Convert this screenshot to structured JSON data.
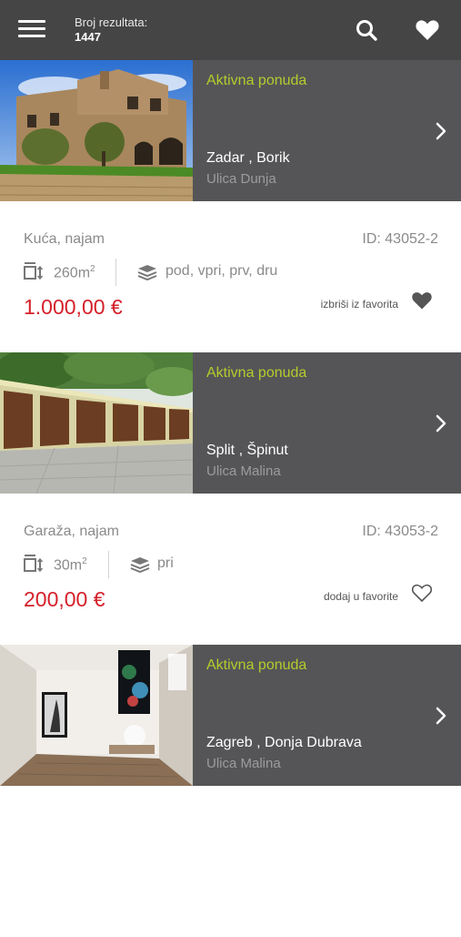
{
  "header": {
    "results_label": "Broj rezultata:",
    "results_count": "1447"
  },
  "listings": [
    {
      "status": "Aktivna ponuda",
      "city": "Zadar , Borik",
      "street": "Ulica Dunja",
      "type": "Kuća, najam",
      "id": "ID: 43052-2",
      "area": "260m",
      "area_unit_sup": "2",
      "floors": "pod, vpri, prv, dru",
      "price": "1.000,00 €",
      "favorite_action": "izbriši iz favorita",
      "favorited": true
    },
    {
      "status": "Aktivna ponuda",
      "city": "Split , Špinut",
      "street": "Ulica Malina",
      "type": "Garaža, najam",
      "id": "ID: 43053-2",
      "area": "30m",
      "area_unit_sup": "2",
      "floors": "pri",
      "price": "200,00 €",
      "favorite_action": "dodaj u favorite",
      "favorited": false
    },
    {
      "status": "Aktivna ponuda",
      "city": "Zagreb , Donja Dubrava",
      "street": "Ulica Malina"
    }
  ],
  "colors": {
    "header_bg": "#454546",
    "card_bg": "#555557",
    "status_green": "#b5cc2c",
    "price_red": "#d4202a"
  },
  "icons": {
    "menu": "hamburger-icon",
    "search": "search-icon",
    "favorites": "heart-icon",
    "next": "chevron-right-icon",
    "area": "area-dimensions-icon",
    "floors": "layers-icon"
  }
}
